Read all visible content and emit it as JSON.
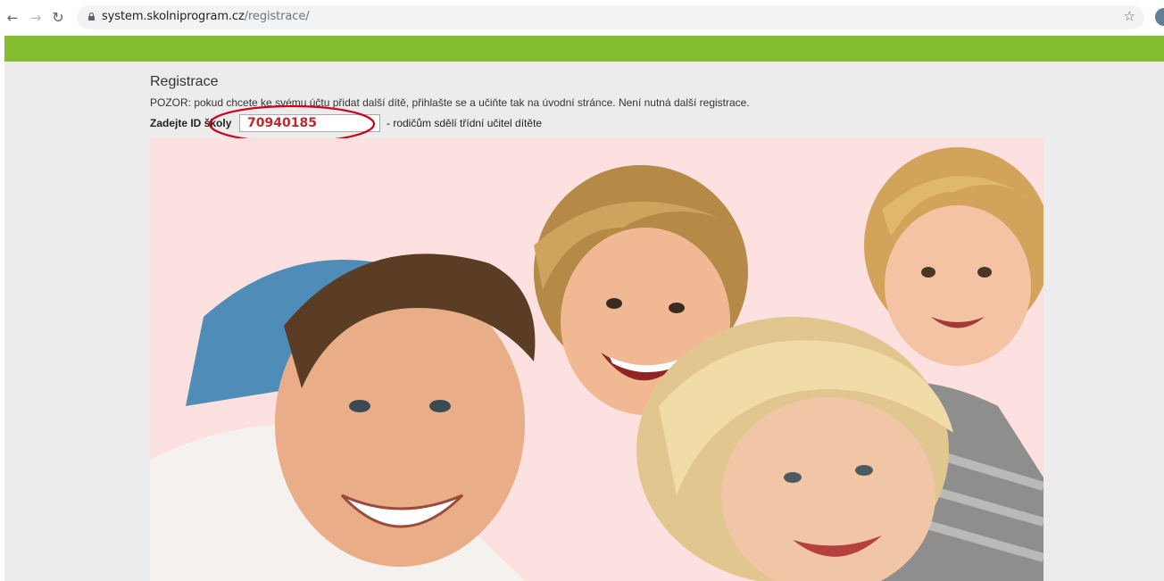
{
  "browser": {
    "back_icon": "arrow-left-icon",
    "forward_icon": "arrow-right-icon",
    "reload_icon": "reload-icon",
    "url_host": "system.skolniprogram.cz",
    "url_path": "/registrace/",
    "bookmark_icon": "star-icon"
  },
  "colors": {
    "top_bar": "#84bd2f",
    "annotation": "#d0021b",
    "input_text": "#c0282d",
    "photo_background": "#fde0e0"
  },
  "registration": {
    "title": "Registrace",
    "warning": "POZOR: pokud chcete ke svému účtu přidat další dítě, přihlašte se a učiňte tak na úvodní stránce. Není nutná další registrace.",
    "school_id_label": "Zadejte ID školy",
    "school_id_value": "70940185",
    "school_id_hint": "- rodičům sdělí třídní učitel dítěte"
  }
}
